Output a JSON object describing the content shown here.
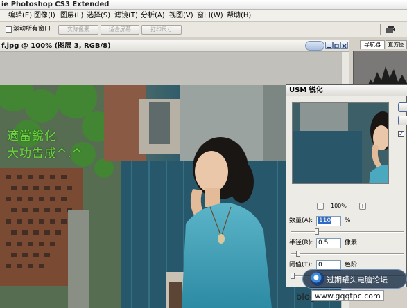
{
  "app": {
    "title": "ie Photoshop CS3 Extended"
  },
  "menu": [
    {
      "label": "编辑(E)"
    },
    {
      "label": "图像(I)"
    },
    {
      "label": "图层(L)"
    },
    {
      "label": "选择(S)"
    },
    {
      "label": "滤镜(T)"
    },
    {
      "label": "分析(A)"
    },
    {
      "label": "视图(V)"
    },
    {
      "label": "窗口(W)"
    },
    {
      "label": "帮助(H)"
    }
  ],
  "options_bar": {
    "scroll_all_windows": "滚动所有窗口",
    "scroll_all_checked": false,
    "buttons": [
      {
        "label": "实际像素"
      },
      {
        "label": "适合屏幕"
      },
      {
        "label": "打印尺寸"
      }
    ]
  },
  "document": {
    "title": "f.jpg @ 100% (图层 3, RGB/8)"
  },
  "right_panel": {
    "tabs": [
      {
        "label": "导航器"
      },
      {
        "label": "直方图"
      }
    ]
  },
  "photo_overlay": {
    "line1": "適當銳化",
    "line2": "大功告成^.^"
  },
  "dialog": {
    "title": "USM 锐化",
    "zoom_level": "100%",
    "zoom_out": "−",
    "zoom_in": "+",
    "preview_checked": true,
    "fields": {
      "amount": {
        "label": "数量(A):",
        "value": "110",
        "unit": "%",
        "level": 0.22
      },
      "radius": {
        "label": "半径(R):",
        "value": "0.5",
        "unit": "像素",
        "level": 0.05
      },
      "threshold": {
        "label": "阈值(T):",
        "value": "0",
        "unit": "色阶",
        "level": 0.0
      }
    }
  },
  "watermark": {
    "forum": "过期罐头电脑论坛",
    "blog": "blog",
    "url": "www.gqqtpc.com"
  },
  "colors": {
    "overlay_text": "#6fd341",
    "selection": "#316ac5"
  }
}
